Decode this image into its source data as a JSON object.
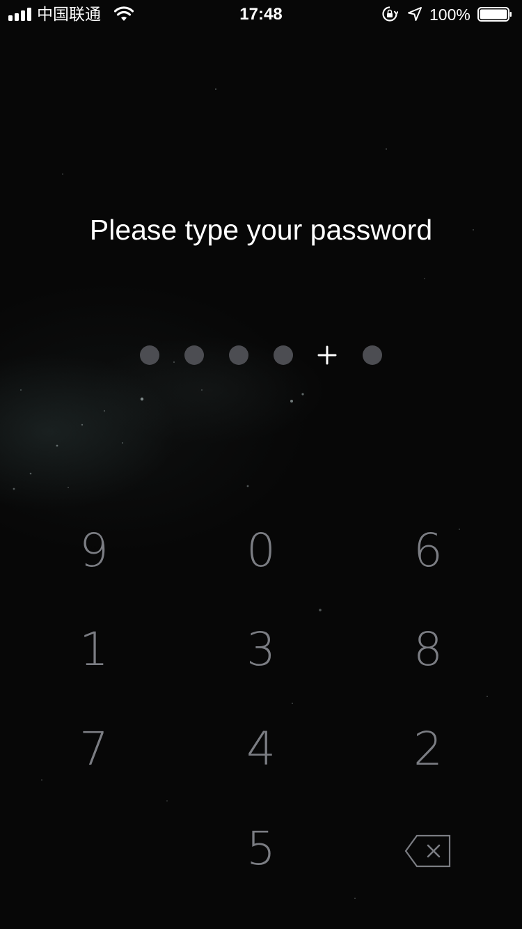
{
  "status_bar": {
    "carrier": "中国联通",
    "time": "17:48",
    "battery_percent": "100%",
    "battery_level": 1.0,
    "signal_bars": 4,
    "icons": [
      "signal-icon",
      "wifi-icon",
      "orientation-lock-icon",
      "location-arrow-icon",
      "battery-icon"
    ]
  },
  "prompt": {
    "text": "Please type your password"
  },
  "passcode": {
    "indicators": [
      "dot",
      "dot",
      "dot",
      "dot",
      "plus",
      "dot"
    ],
    "dot_color": "#4c4d52",
    "plus_color": "#ffffff"
  },
  "keypad": {
    "keys": [
      "9",
      "0",
      "6",
      "1",
      "3",
      "8",
      "7",
      "4",
      "2",
      "5"
    ],
    "key_color": "#7b7d83",
    "delete_icon": "backspace-icon"
  },
  "colors": {
    "background": "#070707",
    "text": "#ffffff"
  }
}
